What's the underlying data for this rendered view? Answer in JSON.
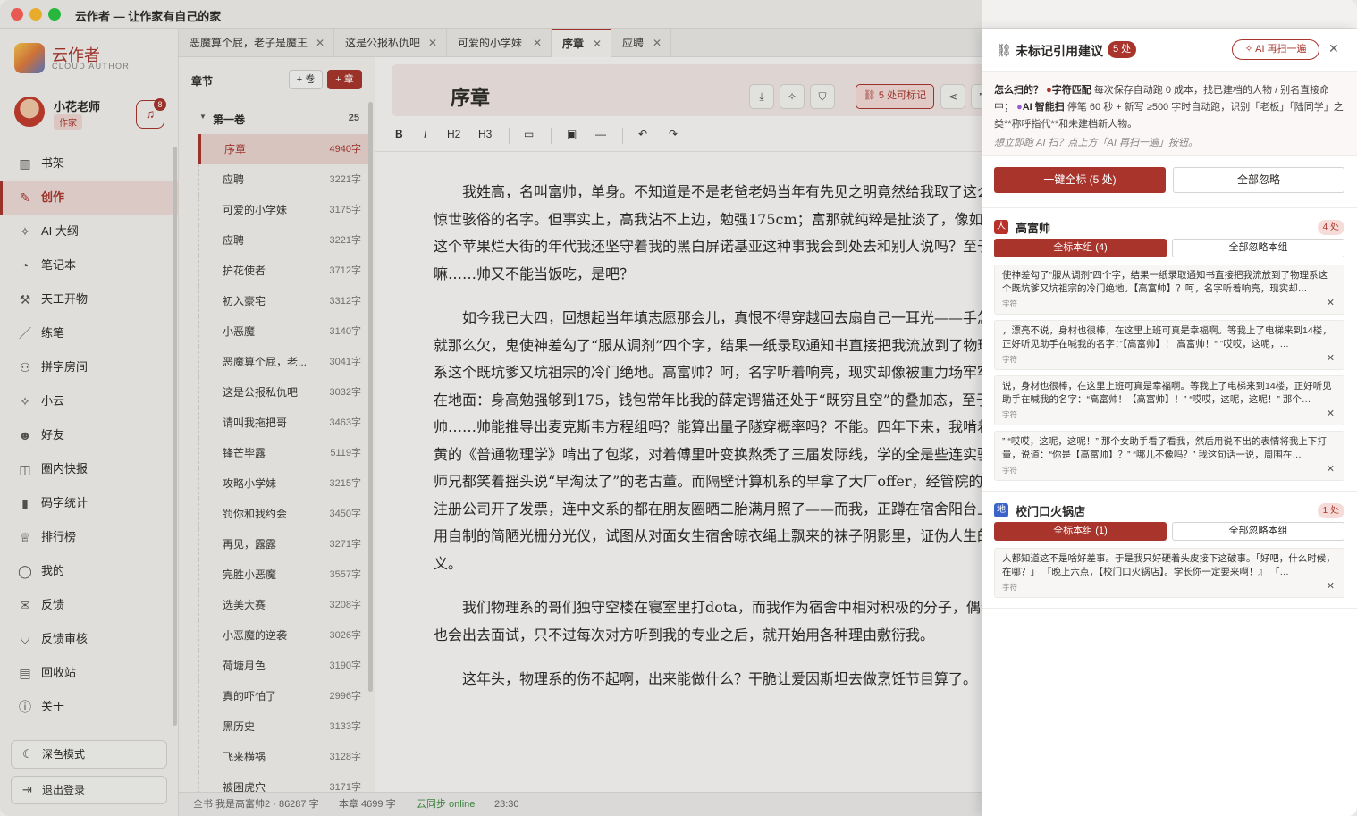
{
  "window": {
    "title": "云作者 — 让作家有自己的家"
  },
  "sidebar": {
    "brand": "云作者",
    "brand_en": "CLOUD AUTHOR",
    "user": {
      "name": "小花老师",
      "role": "作家",
      "notifications": "8"
    },
    "items": [
      {
        "label": "书架",
        "icon": "bookshelf-icon",
        "glyph": "▥",
        "active": false
      },
      {
        "label": "创作",
        "icon": "edit-icon",
        "glyph": "✎",
        "active": true
      },
      {
        "label": "AI 大纲",
        "icon": "sparkle-icon",
        "glyph": "✧",
        "active": false
      },
      {
        "label": "笔记本",
        "icon": "person-icon",
        "glyph": "◔",
        "active": false
      },
      {
        "label": "天工开物",
        "icon": "hammer-icon",
        "glyph": "⚒",
        "active": false
      },
      {
        "label": "练笔",
        "icon": "pen-icon",
        "glyph": "／",
        "active": false
      },
      {
        "label": "拼字房间",
        "icon": "users-icon",
        "glyph": "⚇",
        "active": false
      },
      {
        "label": "小云",
        "icon": "sparkle-icon",
        "glyph": "✧",
        "active": false
      },
      {
        "label": "好友",
        "icon": "smile-icon",
        "glyph": "☻",
        "active": false
      },
      {
        "label": "圈内快报",
        "icon": "chat-icon",
        "glyph": "◫",
        "active": false
      },
      {
        "label": "码字统计",
        "icon": "bar-chart-icon",
        "glyph": "▮",
        "active": false
      },
      {
        "label": "排行榜",
        "icon": "trophy-icon",
        "glyph": "♕",
        "active": false
      },
      {
        "label": "我的",
        "icon": "user-icon",
        "glyph": "◯",
        "active": false
      },
      {
        "label": "反馈",
        "icon": "feedback-icon",
        "glyph": "✉",
        "active": false
      },
      {
        "label": "反馈审核",
        "icon": "shield-icon",
        "glyph": "⛉",
        "active": false
      },
      {
        "label": "回收站",
        "icon": "trash-icon",
        "glyph": "▤",
        "active": false
      },
      {
        "label": "关于",
        "icon": "info-icon",
        "glyph": "ⓘ",
        "active": false
      }
    ],
    "dark_mode": "深色模式",
    "logout": "退出登录"
  },
  "tabs": [
    {
      "label": "恶魔算个屁，老子是魔王",
      "active": false
    },
    {
      "label": "这是公报私仇吧",
      "active": false
    },
    {
      "label": "可爱的小学妹",
      "active": false
    },
    {
      "label": "序章",
      "active": true
    },
    {
      "label": "应聘",
      "active": false
    }
  ],
  "chapters": {
    "header": "章节",
    "add_volume": "+ 卷",
    "add_chapter": "+ 章",
    "volume": {
      "title": "第一卷",
      "count": "25"
    },
    "items": [
      {
        "title": "序章",
        "words": "4940字",
        "active": true
      },
      {
        "title": "应聘",
        "words": "3221字"
      },
      {
        "title": "可爱的小学妹",
        "words": "3175字"
      },
      {
        "title": "应聘",
        "words": "3221字"
      },
      {
        "title": "护花使者",
        "words": "3712字"
      },
      {
        "title": "初入豪宅",
        "words": "3312字"
      },
      {
        "title": "小恶魔",
        "words": "3140字"
      },
      {
        "title": "恶魔算个屁，老...",
        "words": "3041字"
      },
      {
        "title": "这是公报私仇吧",
        "words": "3032字"
      },
      {
        "title": "请叫我拖把哥",
        "words": "3463字"
      },
      {
        "title": "锋芒毕露",
        "words": "5119字"
      },
      {
        "title": "攻略小学妹",
        "words": "3215字"
      },
      {
        "title": "罚你和我约会",
        "words": "3450字"
      },
      {
        "title": "再见，露露",
        "words": "3271字"
      },
      {
        "title": "完胜小恶魔",
        "words": "3557字"
      },
      {
        "title": "选美大赛",
        "words": "3208字"
      },
      {
        "title": "小恶魔的逆袭",
        "words": "3026字"
      },
      {
        "title": "荷塘月色",
        "words": "3190字"
      },
      {
        "title": "真的吓怕了",
        "words": "2996字"
      },
      {
        "title": "黑历史",
        "words": "3133字"
      },
      {
        "title": "飞来横祸",
        "words": "3128字"
      },
      {
        "title": "被困虎穴",
        "words": "3171字"
      }
    ]
  },
  "editor": {
    "title": "序章",
    "mark_button": "5 处可标记",
    "toolbar": {
      "bold": "B",
      "italic": "I",
      "h2": "H2",
      "h3": "H3"
    },
    "paragraphs": [
      "我姓高，名叫富帅，单身。不知道是不是老爸老妈当年有先见之明竟然给我取了这么个惊世骇俗的名字。但事实上，高我沾不上边，勉强175cm；富那就纯粹是扯淡了，像如今这个苹果烂大街的年代我还坚守着我的黑白屏诺基亚这种事我会到处去和别人说吗？至于帅嘛……帅又不能当饭吃，是吧？",
      "如今我已大四，回想起当年填志愿那会儿，真恨不得穿越回去扇自己一耳光——手怎么就那么欠，鬼使神差勾了“服从调剂”四个字，结果一纸录取通知书直接把我流放到了物理系这个既坑爹又坑祖宗的冷门绝地。高富帅？呵，名字听着响亮，现实却像被重力场牢牢钉在地面：身高勉强够到175，钱包常年比我的薛定谔猫还处于“既穷且空”的叠加态，至于帅……帅能推导出麦克斯韦方程组吗？能算出量子隧穿概率吗？不能。四年下来，我啃着泛黄的《普通物理学》啃出了包浆，对着傅里叶变换熬秃了三届发际线，学的全是些连实验室师兄都笑着摇头说“早淘汰了”的老古董。而隔壁计算机系的早拿了大厂offer，经管院的已注册公司开了发票，连中文系的都在朋友圈晒二胎满月照了——而我，正蹲在宿舍阳台上，用自制的简陋光栅分光仪，试图从对面女生宿舍晾衣绳上飘来的袜子阴影里，证伪人生的意义。",
      "我们物理系的哥们独守空楼在寝室里打dota，而我作为宿舍中相对积极的分子，偶尔也会出去面试，只不过每次对方听到我的专业之后，就开始用各种理由敷衍我。",
      "这年头，物理系的伤不起啊，出来能做什么？干脆让爱因斯坦去做烹饪节目算了。"
    ]
  },
  "status": {
    "book": "全书 我是高富帅2 · 86287 字",
    "chapter": "本章 4699 字",
    "sync": "云同步 online",
    "time": "23:30"
  },
  "panel": {
    "title": "未标记引用建议",
    "badge": "5 处",
    "rescan": "AI 再扫一遍",
    "info_q": "怎么扫的？",
    "info_char": "字符匹配",
    "info_char_desc": "每次保存自动跑 0 成本，找已建档的人物 / 别名直接命中；",
    "info_ai": "AI 智能扫",
    "info_ai_desc": "停笔 60 秒 + 新写 ≥500 字时自动跑，识别「老板」「陆同学」之类**称呼指代**和未建档新人物。",
    "info_hint": "想立即跑 AI 扫？点上方「AI 再扫一遍」按钮。",
    "mark_all": "一键全标 (5 处)",
    "ignore_all": "全部忽略",
    "groups": [
      {
        "icon_text": "人",
        "icon_color": "#b8322a",
        "name": "高富帅",
        "count": "4 处",
        "mark_label": "全标本组 (4)",
        "ignore_label": "全部忽略本组",
        "snippets": [
          {
            "text": "使神差勾了“服从调剂”四个字，结果一纸录取通知书直接把我流放到了物理系这个既坑爹又坑祖宗的冷门绝地。【高富帅】？呵，名字听着响亮，现实却…",
            "kind": "字符"
          },
          {
            "text": "，漂亮不说，身材也很棒，在这里上班可真是幸福啊。等我上了电梯来到14楼，正好听见助手在喊我的名字：”【高富帅】！ 高富帅！“ ”哎哎，这呢，…",
            "kind": "字符"
          },
          {
            "text": "说，身材也很棒，在这里上班可真是幸福啊。等我上了电梯来到14楼，正好听见助手在喊我的名字：“高富帅！【高富帅】！” “哎哎，这呢，这呢！” 那个…",
            "kind": "字符"
          },
          {
            "text": "” “哎哎，这呢，这呢！” 那个女助手看了看我，然后用说不出的表情将我上下打量，说道：“你是【高富帅】？” “哪儿不像吗？” 我这句话一说，周围在…",
            "kind": "字符"
          }
        ]
      },
      {
        "icon_text": "地",
        "icon_color": "#3a64c9",
        "name": "校门口火锅店",
        "count": "1 处",
        "mark_label": "全标本组 (1)",
        "ignore_label": "全部忽略本组",
        "snippets": [
          {
            "text": "人都知道这不是啥好差事。于是我只好硬着头皮接下这破事。「好吧，什么时候，在哪？」 『晚上六点，【校门口火锅店】。学长你一定要来啊！』 「…",
            "kind": "字符"
          }
        ]
      }
    ]
  }
}
